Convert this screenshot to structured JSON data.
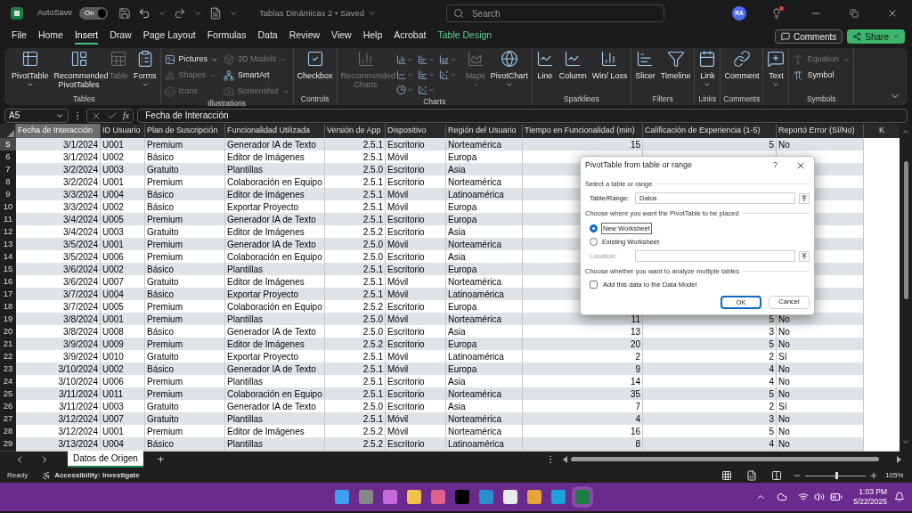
{
  "titlebar": {
    "autosave_label": "AutoSave",
    "autosave_state": "On",
    "autosave_on": true,
    "document_title": "Tablas Dinámicas 2 • Saved",
    "search_placeholder": "Search",
    "avatar": "RA",
    "notification": true
  },
  "menu_tabs": [
    {
      "label": "File",
      "selected": false,
      "kind": "normal"
    },
    {
      "label": "Home",
      "selected": false,
      "kind": "normal"
    },
    {
      "label": "Insert",
      "selected": true,
      "kind": "normal"
    },
    {
      "label": "Draw",
      "selected": false,
      "kind": "normal"
    },
    {
      "label": "Page Layout",
      "selected": false,
      "kind": "normal"
    },
    {
      "label": "Formulas",
      "selected": false,
      "kind": "normal"
    },
    {
      "label": "Data",
      "selected": false,
      "kind": "normal"
    },
    {
      "label": "Review",
      "selected": false,
      "kind": "normal"
    },
    {
      "label": "View",
      "selected": false,
      "kind": "normal"
    },
    {
      "label": "Help",
      "selected": false,
      "kind": "normal"
    },
    {
      "label": "Acrobat",
      "selected": false,
      "kind": "normal"
    },
    {
      "label": "Table Design",
      "selected": false,
      "kind": "contextual"
    }
  ],
  "comments_button": "Comments",
  "share_button": "Share",
  "ribbon_groups": [
    {
      "label": "Tables",
      "items": [
        {
          "label": "PivotTable",
          "kind": "large",
          "disabled": false,
          "dropdown": true
        },
        {
          "label": "Recommended PivotTables",
          "kind": "large",
          "disabled": false,
          "dropdown": false
        },
        {
          "label": "Table",
          "kind": "large",
          "disabled": true,
          "dropdown": false
        },
        {
          "label": "Forms",
          "kind": "large",
          "disabled": false,
          "dropdown": true
        }
      ]
    },
    {
      "label": "Illustrations",
      "items": [
        {
          "label": "Pictures",
          "kind": "small",
          "disabled": false,
          "dropdown": true
        },
        {
          "label": "Shapes",
          "kind": "small",
          "disabled": true,
          "dropdown": true
        },
        {
          "label": "Icons",
          "kind": "small",
          "disabled": true,
          "dropdown": false
        },
        {
          "label": "3D Models",
          "kind": "small",
          "disabled": true,
          "dropdown": true
        },
        {
          "label": "SmartArt",
          "kind": "small",
          "disabled": false,
          "dropdown": false
        },
        {
          "label": "Screenshot",
          "kind": "small",
          "disabled": true,
          "dropdown": true
        }
      ]
    },
    {
      "label": "Controls",
      "items": [
        {
          "label": "Checkbox",
          "kind": "large",
          "disabled": false,
          "dropdown": false
        }
      ]
    },
    {
      "label": "Charts",
      "items": [
        {
          "label": "Recommended Charts",
          "kind": "large",
          "disabled": true,
          "dropdown": false
        },
        {
          "kind": "icon",
          "disabled": false,
          "dropdown": true
        },
        {
          "kind": "icon",
          "disabled": false,
          "dropdown": true
        },
        {
          "kind": "icon",
          "disabled": false,
          "dropdown": true
        },
        {
          "kind": "icon",
          "disabled": false,
          "dropdown": true
        },
        {
          "kind": "icon",
          "disabled": false,
          "dropdown": true
        },
        {
          "kind": "icon",
          "disabled": false,
          "dropdown": true
        },
        {
          "kind": "icon",
          "disabled": false,
          "dropdown": true
        },
        {
          "kind": "icon",
          "disabled": false,
          "dropdown": true
        },
        {
          "label": "Maps",
          "kind": "large",
          "disabled": true,
          "dropdown": true
        },
        {
          "label": "PivotChart",
          "kind": "large",
          "disabled": false,
          "dropdown": true
        }
      ]
    },
    {
      "label": "Sparklines",
      "items": [
        {
          "label": "Line",
          "kind": "large",
          "disabled": false,
          "dropdown": false
        },
        {
          "label": "Column",
          "kind": "large",
          "disabled": false,
          "dropdown": false
        },
        {
          "label": "Win/ Loss",
          "kind": "large",
          "disabled": false,
          "dropdown": false
        }
      ]
    },
    {
      "label": "Filters",
      "items": [
        {
          "label": "Slicer",
          "kind": "large",
          "disabled": false,
          "dropdown": false
        },
        {
          "label": "Timeline",
          "kind": "large",
          "disabled": false,
          "dropdown": false
        }
      ]
    },
    {
      "label": "Links",
      "items": [
        {
          "label": "Link",
          "kind": "large",
          "disabled": false,
          "dropdown": true
        }
      ]
    },
    {
      "label": "Comments",
      "items": [
        {
          "label": "Comment",
          "kind": "large",
          "disabled": false,
          "dropdown": false
        }
      ]
    },
    {
      "items": [
        {
          "label": "Text",
          "kind": "large",
          "disabled": false,
          "dropdown": true
        }
      ]
    },
    {
      "label": "Symbols",
      "items": [
        {
          "label": "Equation",
          "kind": "small",
          "disabled": true,
          "dropdown": true
        },
        {
          "label": "Symbol",
          "kind": "small",
          "disabled": false,
          "dropdown": false
        }
      ]
    }
  ],
  "formula_bar": {
    "name_box": "A5",
    "function_label": "fx",
    "formula": "Fecha de Interacción"
  },
  "table": {
    "columns": [
      {
        "label": "Fecha de Interacción",
        "kind": "number",
        "selected": true
      },
      {
        "label": "ID Usuario",
        "kind": "text",
        "selected": false
      },
      {
        "label": "Plan de Suscripción",
        "kind": "text",
        "selected": false
      },
      {
        "label": "Funcionalidad Utilizada",
        "kind": "text",
        "selected": false
      },
      {
        "label": "Versión de App",
        "kind": "number",
        "selected": false
      },
      {
        "label": "Dispositivo",
        "kind": "text",
        "selected": false
      },
      {
        "label": "Región del Usuario",
        "kind": "text",
        "selected": false
      },
      {
        "label": "Tiempo en Funcionalidad (min)",
        "kind": "number",
        "selected": false
      },
      {
        "label": "Calificación de Experiencia (1-5)",
        "kind": "number",
        "selected": false
      },
      {
        "label": "Reportó Error (Sí/No)",
        "kind": "text",
        "selected": false
      }
    ],
    "extra_column": "K",
    "rows": [
      {
        "number": "5",
        "selected": true,
        "cells": [
          "3/1/2024",
          "U001",
          "Premium",
          "Generador IA de Texto",
          "2.5.1",
          "Escritorio",
          "Norteamérica",
          "15",
          "5",
          "No"
        ]
      },
      {
        "number": "6",
        "selected": false,
        "cells": [
          "3/1/2024",
          "U002",
          "Básico",
          "Editor de Imágenes",
          "2.5.1",
          "Móvil",
          "Europa"
        ]
      },
      {
        "number": "7",
        "selected": false,
        "cells": [
          "3/2/2024",
          "U003",
          "Gratuito",
          "Plantillas",
          "2.5.0",
          "Escritorio",
          "Asia"
        ]
      },
      {
        "number": "8",
        "selected": false,
        "cells": [
          "3/2/2024",
          "U001",
          "Premium",
          "Colaboración en Equipo",
          "2.5.1",
          "Escritorio",
          "Norteamérica"
        ]
      },
      {
        "number": "9",
        "selected": false,
        "cells": [
          "3/3/2024",
          "U004",
          "Básico",
          "Editor de Imágenes",
          "2.5.1",
          "Móvil",
          "Latinoamérica"
        ]
      },
      {
        "number": "10",
        "selected": false,
        "cells": [
          "3/3/2024",
          "U002",
          "Básico",
          "Exportar Proyecto",
          "2.5.1",
          "Móvil",
          "Europa"
        ]
      },
      {
        "number": "11",
        "selected": false,
        "cells": [
          "3/4/2024",
          "U005",
          "Premium",
          "Generador IA de Texto",
          "2.5.1",
          "Escritorio",
          "Europa"
        ]
      },
      {
        "number": "12",
        "selected": false,
        "cells": [
          "3/4/2024",
          "U003",
          "Gratuito",
          "Editor de Imágenes",
          "2.5.2",
          "Escritorio",
          "Asia"
        ]
      },
      {
        "number": "13",
        "selected": false,
        "cells": [
          "3/5/2024",
          "U001",
          "Premium",
          "Generador IA de Texto",
          "2.5.0",
          "Móvil",
          "Norteamérica"
        ]
      },
      {
        "number": "14",
        "selected": false,
        "cells": [
          "3/5/2024",
          "U006",
          "Premium",
          "Colaboración en Equipo",
          "2.5.0",
          "Escritorio",
          "Asia"
        ]
      },
      {
        "number": "15",
        "selected": false,
        "cells": [
          "3/6/2024",
          "U002",
          "Básico",
          "Plantillas",
          "2.5.1",
          "Escritorio",
          "Europa"
        ]
      },
      {
        "number": "16",
        "selected": false,
        "cells": [
          "3/6/2024",
          "U007",
          "Gratuito",
          "Editor de Imágenes",
          "2.5.1",
          "Móvil",
          "Norteamérica"
        ]
      },
      {
        "number": "17",
        "selected": false,
        "cells": [
          "3/7/2024",
          "U004",
          "Básico",
          "Exportar Proyecto",
          "2.5.1",
          "Móvil",
          "Latinoamérica"
        ]
      },
      {
        "number": "18",
        "selected": false,
        "cells": [
          "3/7/2024",
          "U005",
          "Premium",
          "Colaboración en Equipo",
          "2.5.2",
          "Escritorio",
          "Europa"
        ]
      },
      {
        "number": "19",
        "selected": false,
        "cells": [
          "3/8/2024",
          "U001",
          "Premium",
          "Plantillas",
          "2.5.0",
          "Móvil",
          "Norteamérica",
          "11",
          "5",
          "No"
        ]
      },
      {
        "number": "20",
        "selected": false,
        "cells": [
          "3/8/2024",
          "U008",
          "Básico",
          "Generador IA de Texto",
          "2.5.0",
          "Escritorio",
          "Asia",
          "13",
          "3",
          "No"
        ]
      },
      {
        "number": "21",
        "selected": false,
        "cells": [
          "3/9/2024",
          "U009",
          "Premium",
          "Editor de Imágenes",
          "2.5.2",
          "Escritorio",
          "Europa",
          "20",
          "5",
          "No"
        ]
      },
      {
        "number": "22",
        "selected": false,
        "cells": [
          "3/9/2024",
          "U010",
          "Gratuito",
          "Exportar Proyecto",
          "2.5.1",
          "Móvil",
          "Latinoamérica",
          "2",
          "2",
          "Sí"
        ]
      },
      {
        "number": "23",
        "selected": false,
        "cells": [
          "3/10/2024",
          "U002",
          "Básico",
          "Generador IA de Texto",
          "2.5.1",
          "Móvil",
          "Europa",
          "9",
          "4",
          "No"
        ]
      },
      {
        "number": "24",
        "selected": false,
        "cells": [
          "3/10/2024",
          "U006",
          "Premium",
          "Plantillas",
          "2.5.1",
          "Escritorio",
          "Asia",
          "14",
          "4",
          "No"
        ]
      },
      {
        "number": "25",
        "selected": false,
        "cells": [
          "3/11/2024",
          "U011",
          "Premium",
          "Colaboración en Equipo",
          "2.5.1",
          "Escritorio",
          "Norteamérica",
          "35",
          "5",
          "No"
        ]
      },
      {
        "number": "26",
        "selected": false,
        "cells": [
          "3/11/2024",
          "U003",
          "Gratuito",
          "Generador IA de Texto",
          "2.5.0",
          "Escritorio",
          "Asia",
          "7",
          "2",
          "Sí"
        ]
      },
      {
        "number": "27",
        "selected": false,
        "cells": [
          "3/12/2024",
          "U007",
          "Gratuito",
          "Plantillas",
          "2.5.1",
          "Móvil",
          "Norteamérica",
          "4",
          "3",
          "No"
        ]
      },
      {
        "number": "28",
        "selected": false,
        "cells": [
          "3/12/2024",
          "U001",
          "Premium",
          "Editor de Imágenes",
          "2.5.2",
          "Móvil",
          "Norteamérica",
          "16",
          "5",
          "No"
        ]
      },
      {
        "number": "29",
        "selected": false,
        "cells": [
          "3/13/2024",
          "U004",
          "Básico",
          "Plantillas",
          "2.5.2",
          "Escritorio",
          "Latinoamérica",
          "8",
          "4",
          "No"
        ]
      }
    ]
  },
  "dialog": {
    "title": "PivotTable from table or range",
    "help_button": "?",
    "section_source": "Select a table or range",
    "range_label": "Table/Range:",
    "range_value": "Datos",
    "section_placement": "Choose where you want the PivotTable to be placed",
    "placement_options": [
      {
        "label": "New Worksheet",
        "selected": true
      },
      {
        "label": "Existing Worksheet",
        "selected": false
      }
    ],
    "location": {
      "label": "Location:",
      "disabled": true
    },
    "section_tables": "Choose whether you want to analyze multiple tables",
    "data_model": {
      "label": "Add this data to the Data Model",
      "checked": false
    },
    "buttons": [
      {
        "label": "OK",
        "default": true
      },
      {
        "label": "Cancel",
        "default": false
      }
    ]
  },
  "sheet_tabs": [
    {
      "label": "Datos de Origen",
      "selected": true
    }
  ],
  "add_sheet": "+",
  "status_bar": {
    "ready": "Ready",
    "accessibility": "Accessibility: Investigate",
    "level": 0.5,
    "zoom": "105%"
  },
  "taskbar": {
    "time": "1:03 PM",
    "date": "5/22/2025"
  }
}
